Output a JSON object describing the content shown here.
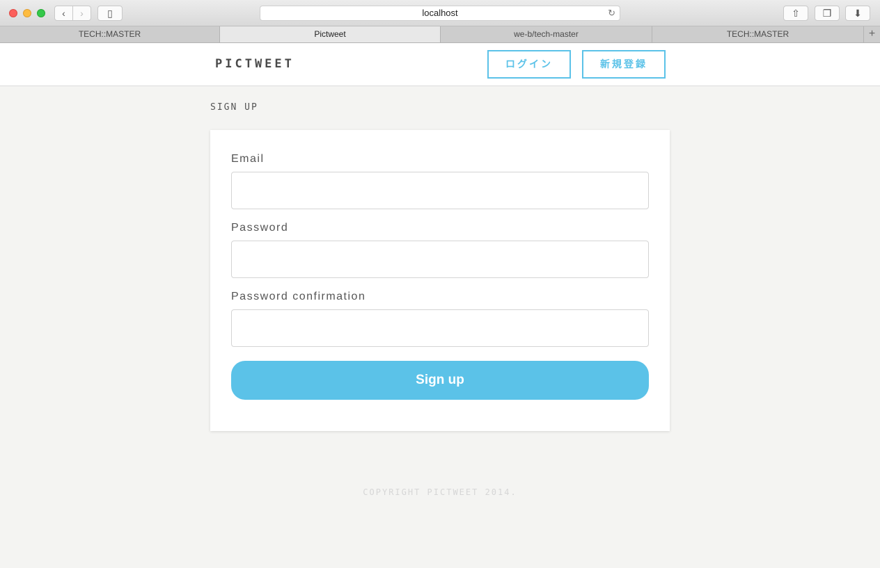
{
  "browser": {
    "url": "localhost",
    "tabs": [
      {
        "label": "TECH::MASTER"
      },
      {
        "label": "Pictweet"
      },
      {
        "label": "we-b/tech-master"
      },
      {
        "label": "TECH::MASTER"
      }
    ],
    "new_tab_glyph": "+",
    "icons": {
      "back": "‹",
      "forward": "›",
      "sidebar": "▯",
      "reload": "↻",
      "share": "⇧",
      "tabs": "❐",
      "download": "⬇"
    }
  },
  "header": {
    "logo": "PICTWEET",
    "login_label": "ログイン",
    "signup_label": "新規登録"
  },
  "page": {
    "title": "SIGN UP"
  },
  "form": {
    "email_label": "Email",
    "password_label": "Password",
    "password_confirmation_label": "Password confirmation",
    "email_value": "",
    "password_value": "",
    "password_confirmation_value": "",
    "submit_label": "Sign up"
  },
  "footer": {
    "copyright": "COPYRIGHT PICTWEET 2014."
  },
  "colors": {
    "accent": "#5bc2e8",
    "background": "#f4f4f2"
  }
}
